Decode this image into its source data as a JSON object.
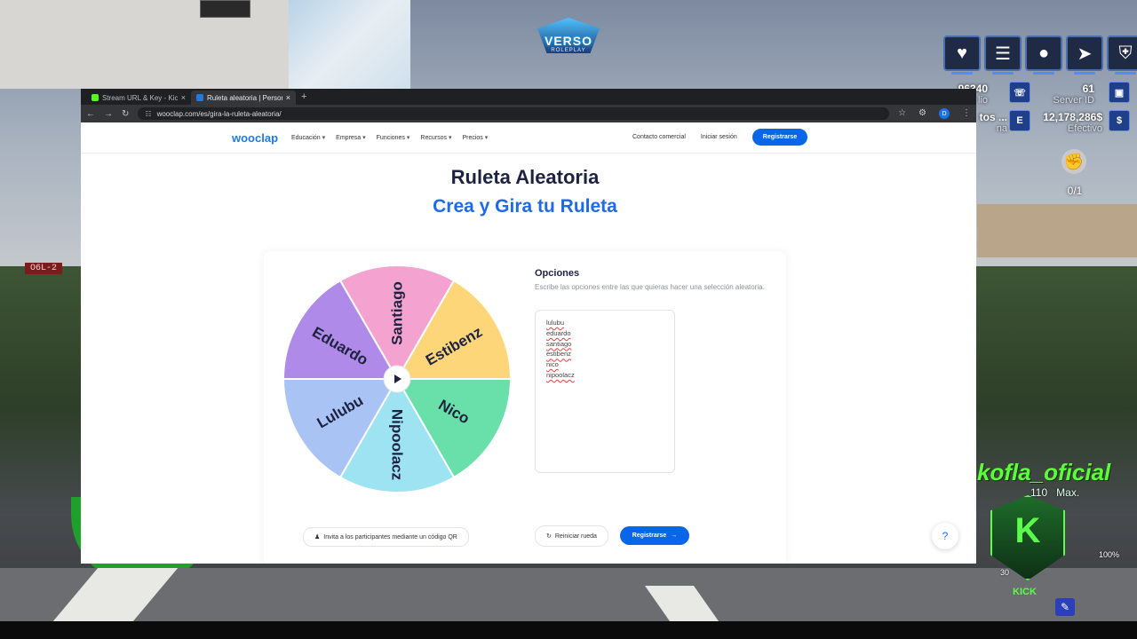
{
  "game": {
    "server_tag": "O6L-2",
    "logo_text": "VERSO",
    "logo_sub": "ROLEPLAY",
    "hud_icons": [
      "heart-icon",
      "armor-icon",
      "water-icon",
      "stamina-icon",
      "shield-icon"
    ],
    "stats": {
      "top_left_value": "96340",
      "top_left_label": "lio",
      "server_id_value": "61",
      "server_id_label": "Server ID",
      "job_value": "tos ...",
      "job_label": "na",
      "cash_value": "12,178,286$",
      "cash_label": "Efectivo",
      "badge_e": "E"
    },
    "fist_count": "0/1",
    "streamer": "kofla_oficial",
    "speed_value": "110",
    "speed_label": "Max.",
    "kick_label": "KICK",
    "battery": "100%",
    "partial_number": "30"
  },
  "browser": {
    "tabs": [
      {
        "title": "Stream URL & Key - Kick Dash"
      },
      {
        "title": "Ruleta aleatoria | Personaliza y"
      }
    ],
    "url": "wooclap.com/es/gira-la-ruleta-aleatoria/",
    "profile_initial": "D"
  },
  "site": {
    "brand": "wooclap",
    "nav": [
      "Educación",
      "Empresa",
      "Funciones",
      "Recursos",
      "Precios"
    ],
    "contact": "Contacto comercial",
    "login": "Iniciar sesión",
    "register": "Registrarse"
  },
  "main": {
    "title": "Ruleta Aleatoria",
    "subtitle": "Crea y Gira tu Ruleta",
    "options_title": "Opciones",
    "options_desc": "Escribe las opciones entre las que quieras hacer una selección aleatoria.",
    "options": [
      "lulubu",
      "eduardo",
      "santiago",
      "estibenz",
      "nico",
      "nipoolacz"
    ],
    "qr_button": "Invita a los participantes mediante un código QR",
    "reset_button": "Reiniciar rueda",
    "register_button": "Registrarse",
    "help": "?"
  },
  "wheel": {
    "segments": [
      {
        "label": "Santiago",
        "color": "#f4a3d0"
      },
      {
        "label": "Estibenz",
        "color": "#fdd67a"
      },
      {
        "label": "Nico",
        "color": "#69e0a9"
      },
      {
        "label": "Nipoolacz",
        "color": "#9de3f2"
      },
      {
        "label": "Lulubu",
        "color": "#a9c3f5"
      },
      {
        "label": "Eduardo",
        "color": "#b08ae8"
      }
    ],
    "text_color": "#1d2240"
  }
}
